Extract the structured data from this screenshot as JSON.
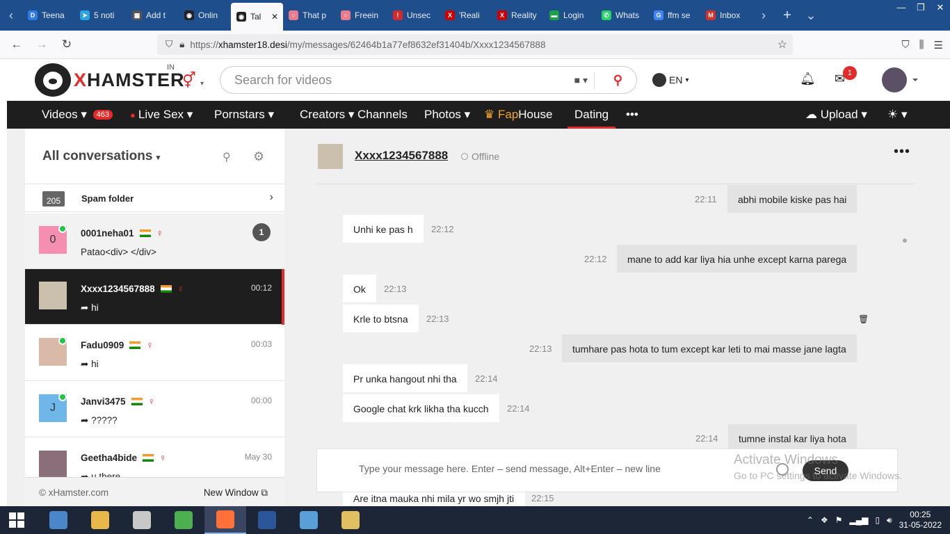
{
  "browser": {
    "tabs": [
      {
        "title": "Teena",
        "fav_color": "#2e7ae6",
        "fav_glyph": "D"
      },
      {
        "title": "5 noti",
        "fav_color": "#2aa3e0",
        "fav_glyph": "➤"
      },
      {
        "title": "Add t",
        "fav_color": "#555555",
        "fav_glyph": "▦"
      },
      {
        "title": "Onlin",
        "fav_color": "#222222",
        "fav_glyph": "◉"
      },
      {
        "title": "Tal",
        "fav_color": "#222222",
        "fav_glyph": "◉",
        "active": true
      },
      {
        "title": "That p",
        "fav_color": "#e87c8c",
        "fav_glyph": "○"
      },
      {
        "title": "Freein",
        "fav_color": "#e87c8c",
        "fav_glyph": "○"
      },
      {
        "title": "Unsec",
        "fav_color": "#d6282a",
        "fav_glyph": "!"
      },
      {
        "title": "'Reali",
        "fav_color": "#cc0000",
        "fav_glyph": "X"
      },
      {
        "title": "Reality",
        "fav_color": "#cc0000",
        "fav_glyph": "X"
      },
      {
        "title": "Login",
        "fav_color": "#1aa14a",
        "fav_glyph": "▬"
      },
      {
        "title": "Whats",
        "fav_color": "#25d366",
        "fav_glyph": "✆"
      },
      {
        "title": "ffm se",
        "fav_color": "#4285f4",
        "fav_glyph": "G"
      },
      {
        "title": "Inbox",
        "fav_color": "#d93025",
        "fav_glyph": "M"
      }
    ],
    "url_prefix": "https://",
    "url_host": "xhamster18.desi",
    "url_path": "/my/messages/62464b1a77ef8632ef31404b/Xxxx1234567888"
  },
  "site": {
    "brand_x": "X",
    "brand_rest": "HAMSTER",
    "country": "IN",
    "search_placeholder": "Search for videos",
    "lang": "EN",
    "mail_count": "1",
    "nav": {
      "videos": "Videos",
      "videos_count": "463",
      "live": "Live Sex",
      "pornstars": "Pornstars",
      "creators": "Creators",
      "channels": "Channels",
      "photos": "Photos",
      "fap": "Fap",
      "house": "House",
      "dating": "Dating",
      "more": "•••",
      "upload": "Upload"
    }
  },
  "conversations": {
    "title": "All conversations",
    "spam_count": "205",
    "spam_label": "Spam folder",
    "items": [
      {
        "name": "0001neha01",
        "initial": "0",
        "avatar_color": "#f48fb1",
        "online": true,
        "message": "Patao<div> </div>",
        "time": "",
        "unread": "1",
        "state": "gray"
      },
      {
        "name": "Xxxx1234567888",
        "initial": "",
        "avatar_color": "#cbbfae",
        "online": false,
        "message": "hi",
        "time": "00:12",
        "unread": "",
        "state": "sel"
      },
      {
        "name": "Fadu0909",
        "initial": "",
        "avatar_color": "#d9b9a8",
        "online": true,
        "message": "hi",
        "time": "00:03",
        "unread": "",
        "state": ""
      },
      {
        "name": "Janvi3475",
        "initial": "J",
        "avatar_color": "#6fb7e8",
        "online": true,
        "message": "?????",
        "time": "00:00",
        "unread": "",
        "state": ""
      },
      {
        "name": "Geetha4bide",
        "initial": "",
        "avatar_color": "#8a6f7a",
        "online": false,
        "message": "u there",
        "time": "May 30",
        "unread": "",
        "state": ""
      }
    ],
    "footer_copy": "© xHamster.com",
    "footer_new_window": "New Window"
  },
  "chat": {
    "partner": "Xxxx1234567888",
    "status": "Offline",
    "messages": [
      {
        "dir": "out",
        "text": "abhi mobile kiske pas hai",
        "time": "22:11"
      },
      {
        "dir": "in",
        "text": "Unhi ke pas h",
        "time": "22:12"
      },
      {
        "dir": "out",
        "text": "mane to add kar liya hia unhe except karna parega",
        "time": "22:12"
      },
      {
        "dir": "in",
        "text": "Ok",
        "time": "22:13"
      },
      {
        "dir": "in",
        "text": "Krle to btsna",
        "time": "22:13"
      },
      {
        "dir": "out",
        "text": "tumhare pas hota to tum except kar leti to mai masse jane lagta",
        "time": "22:13"
      },
      {
        "dir": "in",
        "text": "Pr unka hangout nhi tha",
        "time": "22:14"
      },
      {
        "dir": "in",
        "text": "Google chat krk likha tha kucch",
        "time": "22:14"
      },
      {
        "dir": "out",
        "text": "tumne instal kar liya hota",
        "time": "22:14"
      }
    ],
    "last_in": {
      "text": "Are itna mauka nhi mila yr wo smjh jti",
      "time": "22:15"
    },
    "composer_placeholder": "Type your message here. Enter – send message, Alt+Enter – new line",
    "send_label": "Send"
  },
  "watermark": {
    "line1": "Activate Windows",
    "line2": "Go to PC settings to activate Windows."
  },
  "taskbar": {
    "apps": [
      {
        "name": "this-pc",
        "color": "#4a86c8"
      },
      {
        "name": "file-explorer",
        "color": "#e8b94a"
      },
      {
        "name": "clock-app",
        "color": "#c8c8c8"
      },
      {
        "name": "chrome",
        "color": "#4caf50"
      },
      {
        "name": "firefox",
        "color": "#ff7139",
        "active": true
      },
      {
        "name": "word",
        "color": "#2b579a"
      },
      {
        "name": "photos",
        "color": "#5aa0d8"
      },
      {
        "name": "paint",
        "color": "#e0c060"
      }
    ],
    "time": "00:25",
    "date": "31-05-2022"
  }
}
